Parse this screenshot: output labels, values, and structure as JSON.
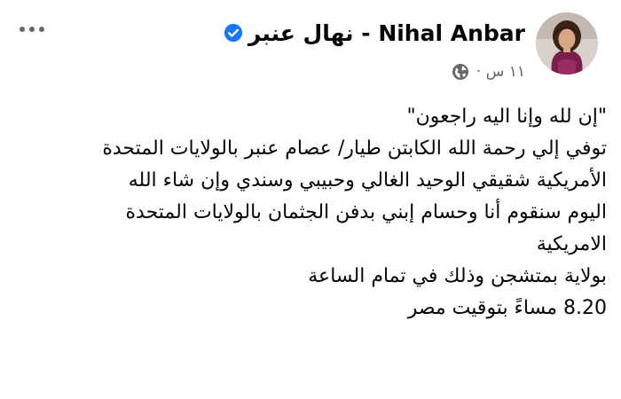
{
  "post": {
    "author": {
      "name": "نهال عنبر - Nihal Anbar",
      "verified": true,
      "avatar_icon": "profile-photo"
    },
    "meta": {
      "timestamp": "١١ س ·",
      "audience_icon": "globe-icon"
    },
    "menu_icon": "more-options-icon",
    "body_lines": [
      "\"إن لله وإنا اليه راجعون\"",
      "توفي إلي رحمة الله الكابتن طيار/ عصام عنبر بالولايات المتحدة",
      "الأمريكية شقيقي الوحيد الغالي وحبيبي وسندي وإن شاء الله",
      "اليوم سنقوم أنا وحسام إبني بدفن الجثمان بالولايات المتحدة",
      "الامريكية",
      "بولاية بمتشجن وذلك في تمام الساعة",
      "8.20 مساءً بتوقيت مصر"
    ]
  },
  "colors": {
    "verified_badge": "#1877f2",
    "text_primary": "#050505",
    "text_secondary": "#65676b",
    "icon_gray": "#606770",
    "avatar_dress": "#7a1f4a"
  }
}
